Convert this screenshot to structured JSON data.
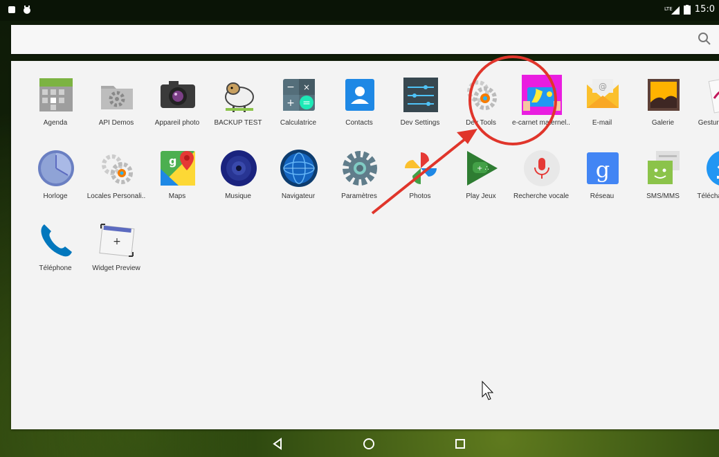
{
  "status": {
    "time": "15:0",
    "network": "LTE"
  },
  "search": {
    "icon": "search-icon"
  },
  "apps": [
    {
      "label": "Agenda",
      "icon": "agenda-icon"
    },
    {
      "label": "API Demos",
      "icon": "folder-gear-icon"
    },
    {
      "label": "Appareil photo",
      "icon": "camera-icon"
    },
    {
      "label": "BACKUP TEST",
      "icon": "sheep-icon"
    },
    {
      "label": "Calculatrice",
      "icon": "calculator-icon"
    },
    {
      "label": "Contacts",
      "icon": "contacts-icon"
    },
    {
      "label": "Dev Settings",
      "icon": "dev-settings-icon"
    },
    {
      "label": "Dev Tools",
      "icon": "dev-tools-icon"
    },
    {
      "label": "e-carnet maternel..",
      "icon": "e-carnet-icon"
    },
    {
      "label": "E-mail",
      "icon": "email-icon"
    },
    {
      "label": "Galerie",
      "icon": "gallery-icon"
    },
    {
      "label": "Gestures Builder",
      "icon": "gestures-icon"
    },
    {
      "label": "Horloge",
      "icon": "clock-icon"
    },
    {
      "label": "Locales Personali..",
      "icon": "locale-gears-icon"
    },
    {
      "label": "Maps",
      "icon": "maps-icon"
    },
    {
      "label": "Musique",
      "icon": "music-icon"
    },
    {
      "label": "Navigateur",
      "icon": "globe-icon"
    },
    {
      "label": "Paramètres",
      "icon": "settings-gear-icon"
    },
    {
      "label": "Photos",
      "icon": "photos-pinwheel-icon"
    },
    {
      "label": "Play Jeux",
      "icon": "play-games-icon"
    },
    {
      "label": "Recherche vocale",
      "icon": "microphone-icon"
    },
    {
      "label": "Réseau",
      "icon": "google-g-icon"
    },
    {
      "label": "SMS/MMS",
      "icon": "messaging-icon"
    },
    {
      "label": "Téléchargements",
      "icon": "download-icon"
    },
    {
      "label": "Téléphone",
      "icon": "phone-icon"
    },
    {
      "label": "Widget Preview",
      "icon": "widget-preview-icon"
    }
  ],
  "nav": {
    "back": "back-icon",
    "home": "home-icon",
    "recents": "recents-icon"
  },
  "colors": {
    "annotation": "#e0352b",
    "drawer": "#f3f3f3"
  }
}
